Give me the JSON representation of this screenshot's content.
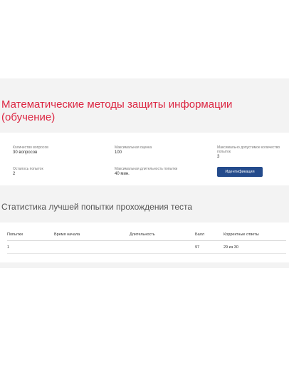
{
  "course": {
    "title": "Математические методы защиты информации (обучение)"
  },
  "info": {
    "questions_label": "Количество вопросов",
    "questions_value": "30 вопросов",
    "max_score_label": "Максимальная оценка",
    "max_score_value": "100",
    "max_attempts_label": "Максимально допустимое количество попыток",
    "max_attempts_value": "3",
    "attempts_left_label": "Осталось попыток",
    "attempts_left_value": "2",
    "max_duration_label": "Максимальная длительность попытки",
    "max_duration_value": "40 мин.",
    "identify_button": "Идентификация"
  },
  "stats": {
    "title": "Статистика лучшей попытки прохождения теста",
    "columns": [
      "Попытки",
      "Время начала",
      "Длительность",
      "Балл",
      "Корректные ответы"
    ],
    "rows": [
      [
        "1",
        "",
        "",
        "97",
        "29 из 30"
      ]
    ]
  },
  "colors": {
    "title_red": "#dc2642",
    "button_blue": "#244b8c",
    "band_gray": "#f3f3f3"
  }
}
